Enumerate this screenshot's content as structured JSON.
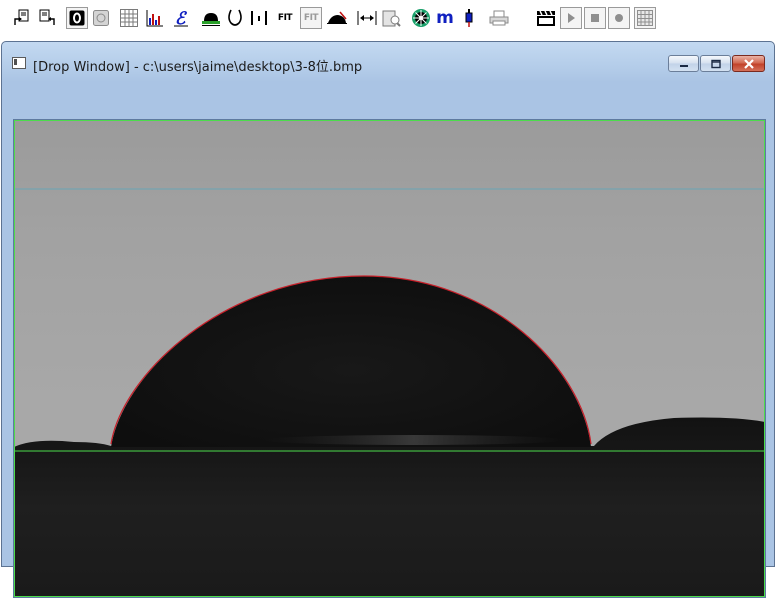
{
  "toolbar": {
    "buttons": [
      {
        "name": "open-image-button",
        "icon": "open-icon"
      },
      {
        "name": "save-image-button",
        "icon": "save-icon"
      },
      {
        "name": "live-video-button",
        "icon": "video-icon",
        "pressed": true
      },
      {
        "name": "freeze-button",
        "icon": "freeze-icon"
      },
      {
        "name": "data-table-button",
        "icon": "table-icon"
      },
      {
        "name": "graph-button",
        "icon": "bar-chart-icon"
      },
      {
        "name": "calibrate-button",
        "icon": "script-e-icon"
      },
      {
        "name": "sessile-drop-button",
        "icon": "sessile-drop-icon"
      },
      {
        "name": "pendant-drop-button",
        "icon": "pendant-drop-icon"
      },
      {
        "name": "needle-button",
        "icon": "needle-icon"
      },
      {
        "name": "fit-button",
        "label": "FIT"
      },
      {
        "name": "fit-all-button",
        "label": "FIT"
      },
      {
        "name": "tilt-button",
        "icon": "tilt-drop-icon"
      },
      {
        "name": "baseline-button",
        "icon": "baseline-icon"
      },
      {
        "name": "analyze-button",
        "icon": "analyze-icon"
      },
      {
        "name": "auto-measure-button",
        "icon": "target-icon"
      },
      {
        "name": "m-button",
        "label": "m"
      },
      {
        "name": "syringe-button",
        "icon": "syringe-icon"
      },
      {
        "name": "print-button",
        "icon": "printer-icon"
      },
      {
        "name": "movie-button",
        "icon": "clapperboard-icon"
      },
      {
        "name": "play-button",
        "icon": "play-icon"
      },
      {
        "name": "stop-button",
        "icon": "stop-icon"
      },
      {
        "name": "record-button",
        "icon": "record-icon"
      },
      {
        "name": "grid-button",
        "icon": "grid-icon"
      }
    ]
  },
  "window": {
    "title": "[Drop Window] - c:\\users\\jaime\\desktop\\3-8位.bmp",
    "controls": [
      "minimize-icon",
      "restore-icon",
      "close-icon"
    ]
  },
  "colors": {
    "accent_blue": "#1020c0",
    "fit_curve": "#c8202a",
    "baseline": "#4cdc4c",
    "ref_line": "#6aa6b6",
    "frame_border": "#5d7392"
  }
}
